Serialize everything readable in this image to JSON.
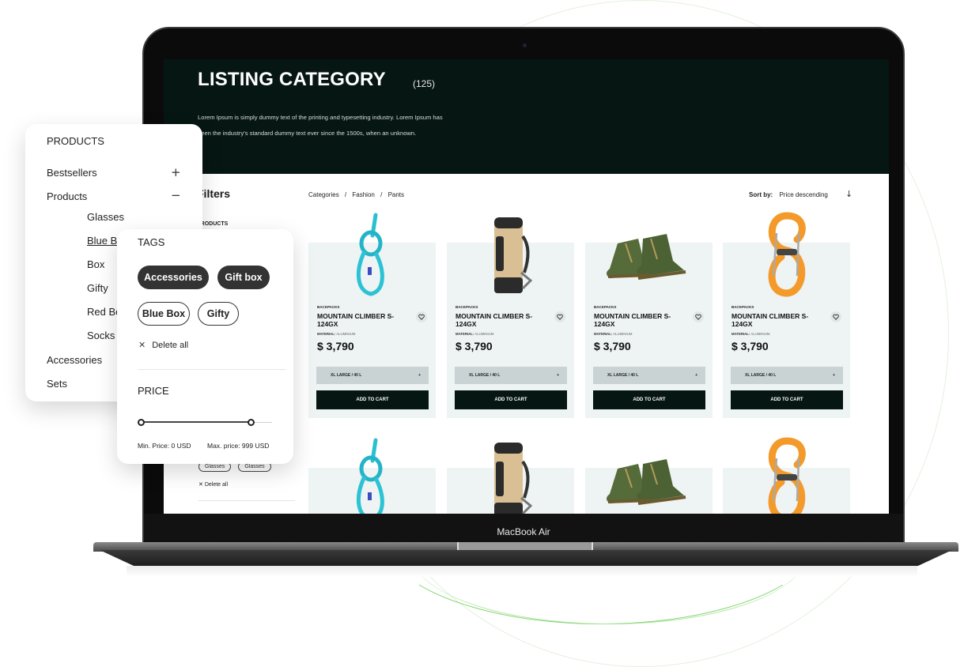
{
  "device": {
    "label": "MacBook Air"
  },
  "hero": {
    "title": "LISTING CATEGORY",
    "count": "(125)",
    "description_line1": "Lorem Ipsum is simply dummy text of the printing and typesetting industry. Lorem Ipsum has",
    "description_line2": "been the industry's standard dummy text ever since the 1500s, when an unknown."
  },
  "filters": {
    "title": "Filters",
    "section": "PRODUCTS",
    "lower_tags": [
      "Glasses",
      "Glasses"
    ],
    "lower_delete": "Delete all"
  },
  "breadcrumb": [
    "Categories",
    "/",
    "Fashion",
    "/",
    "Pants"
  ],
  "sort": {
    "label": "Sort by:",
    "value": "Price descending",
    "arrow_icon": "arrow-down-icon"
  },
  "products": [
    {
      "image": "rope-knot",
      "category": "BACKPACKS",
      "name": "MOUNTAIN CLIMBER S-124GX",
      "material_label": "MATERIAL:",
      "material": "ALUMINIUM",
      "price": "$ 3,790",
      "variant": "XL LARGE / 40 L",
      "variant_icon": "+",
      "cta": "ADD TO CART"
    },
    {
      "image": "backpack",
      "category": "BACKPACKS",
      "name": "MOUNTAIN CLIMBER S-124GX",
      "material_label": "MATERIAL:",
      "material": "ALUMINIUM",
      "price": "$ 3,790",
      "variant": "XL LARGE / 40 L",
      "variant_icon": "+",
      "cta": "ADD TO CART"
    },
    {
      "image": "boots",
      "category": "BACKPACKS",
      "name": "MOUNTAIN CLIMBER S-124GX",
      "material_label": "MATERIAL:",
      "material": "ALUMINIUM",
      "price": "$ 3,790",
      "variant": "XL LARGE / 40 L",
      "variant_icon": "+",
      "cta": "ADD TO CART"
    },
    {
      "image": "carabiner",
      "category": "BACKPACKS",
      "name": "MOUNTAIN CLIMBER S-124GX",
      "material_label": "MATERIAL:",
      "material": "ALUMINIUM",
      "price": "$ 3,790",
      "variant": "XL LARGE / 40 L",
      "variant_icon": "+",
      "cta": "ADD TO CART"
    }
  ],
  "products_panel": {
    "title": "PRODUCTS",
    "items": [
      {
        "label": "Bestsellers",
        "toggle": "+"
      },
      {
        "label": "Products",
        "toggle": "−"
      }
    ],
    "sub_items": [
      "Glasses",
      "Blue Box",
      "Box",
      "Gifty",
      "Red Box",
      "Socks"
    ],
    "bottom_items": [
      "Accessories",
      "Sets"
    ]
  },
  "tags_panel": {
    "title": "TAGS",
    "active_tags": [
      "Accessories",
      "Gift box"
    ],
    "outline_tags": [
      "Blue Box",
      "Gifty"
    ],
    "delete_all": "Delete all",
    "price_title": "PRICE",
    "price_min_fraction": 0,
    "price_max_fraction": 0.84,
    "min_label": "Min. Price: 0 USD",
    "max_label": "Max. price: 999 USD"
  },
  "colors": {
    "hero_bg": "#061613",
    "card_bg": "#eef3f3",
    "variant_bg": "#c9d3d4",
    "cta_bg": "#061613",
    "tag_active": "#333333"
  }
}
